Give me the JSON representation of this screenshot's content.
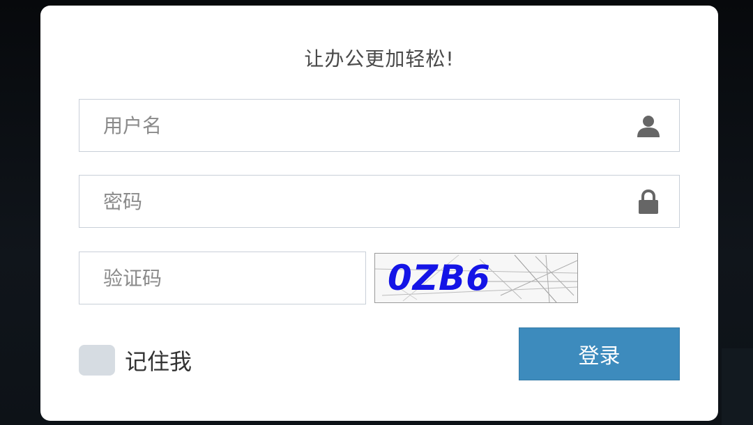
{
  "form": {
    "title": "让办公更加轻松!",
    "username": {
      "placeholder": "用户名",
      "value": "",
      "icon": "user-icon"
    },
    "password": {
      "placeholder": "密码",
      "value": "",
      "icon": "lock-icon"
    },
    "captcha_input": {
      "placeholder": "验证码",
      "value": ""
    },
    "captcha_image": {
      "text": "0ZB6",
      "color": "#1414e6"
    },
    "remember": {
      "label": "记住我",
      "checked": false
    },
    "login_button": {
      "label": "登录",
      "color": "#3d8bbd"
    }
  }
}
